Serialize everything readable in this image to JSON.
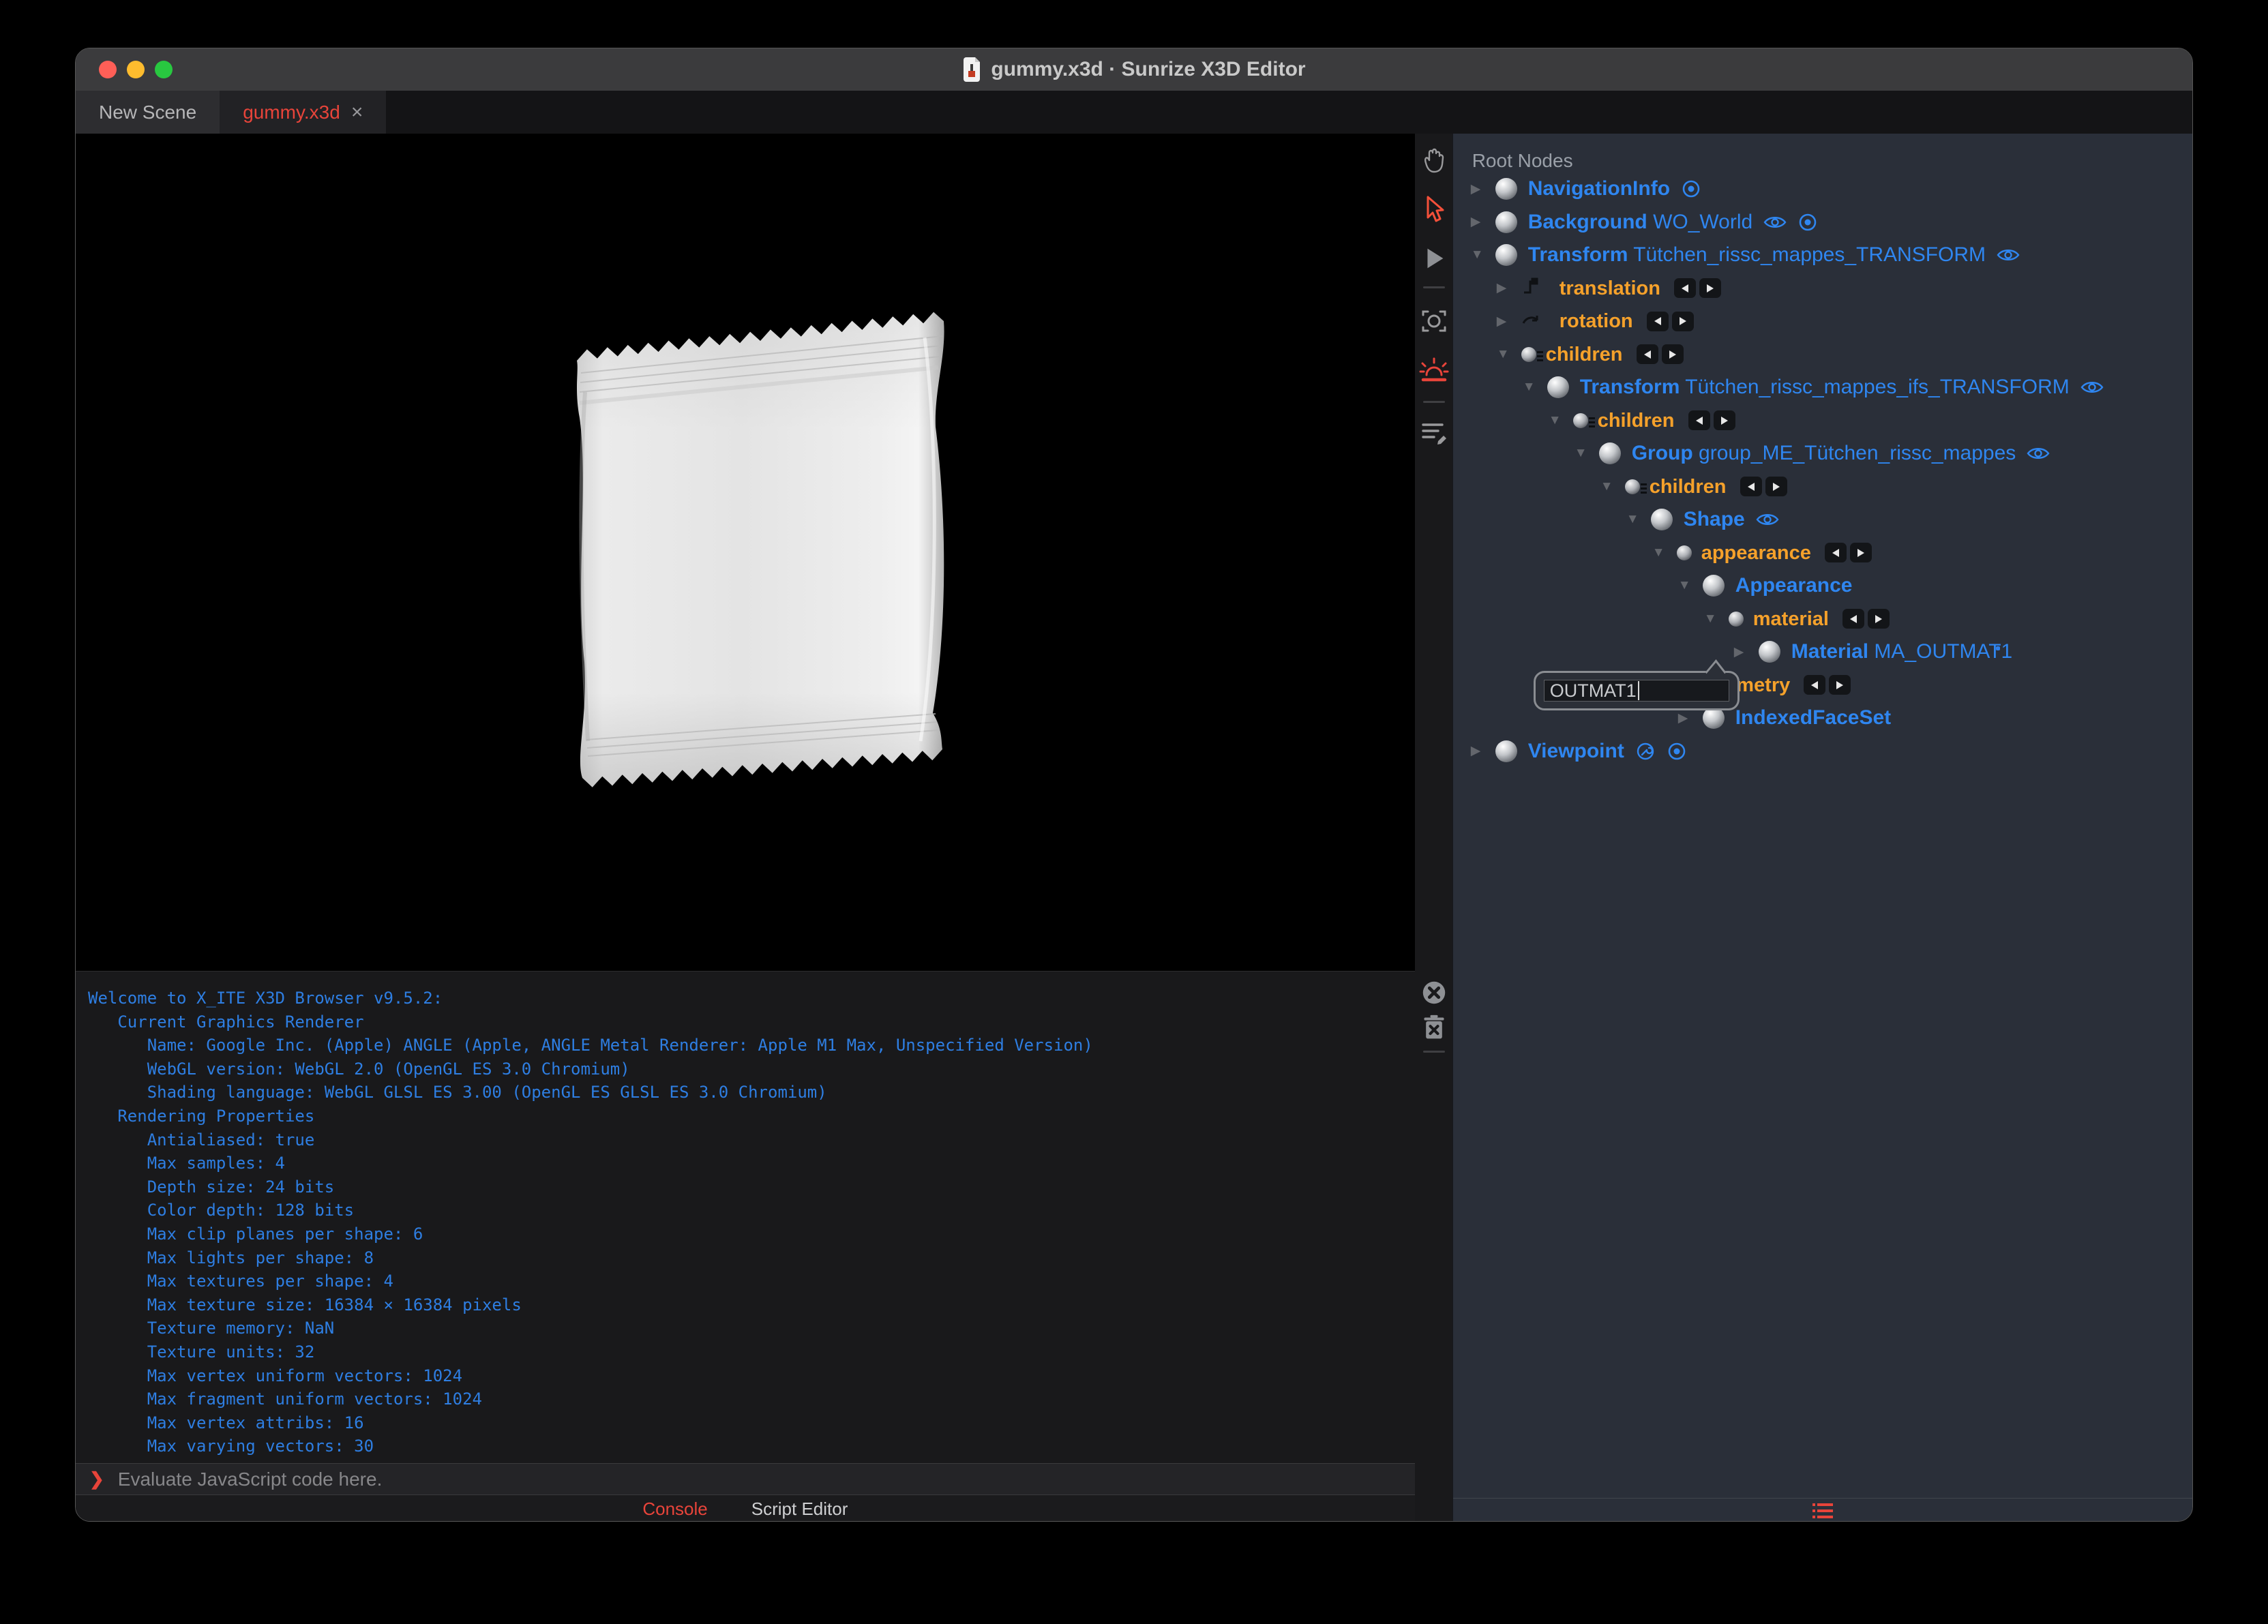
{
  "titlebar": {
    "title": "gummy.x3d · Sunrize X3D Editor"
  },
  "traffic_lights": [
    "close",
    "minimize",
    "zoom"
  ],
  "tabs": {
    "close_glyph": "×",
    "items": [
      {
        "label": "New Scene",
        "active": false,
        "closable": false
      },
      {
        "label": "gummy.x3d",
        "active": true,
        "closable": true
      }
    ]
  },
  "toolbar": {
    "icons": [
      "pan-hand",
      "select-arrow",
      "play",
      "snapshot-camera",
      "sunrise-light",
      "script-edit"
    ],
    "active_icons": [
      "select-arrow",
      "sunrise-light"
    ],
    "console_icons": [
      "clear-console",
      "clear-messages"
    ]
  },
  "viewport": {
    "content": "white flow-wrap pouch package on black background"
  },
  "console": {
    "lines": [
      "Welcome to X_ITE X3D Browser v9.5.2:",
      "   Current Graphics Renderer",
      "      Name: Google Inc. (Apple) ANGLE (Apple, ANGLE Metal Renderer: Apple M1 Max, Unspecified Version)",
      "      WebGL version: WebGL 2.0 (OpenGL ES 3.0 Chromium)",
      "      Shading language: WebGL GLSL ES 3.00 (OpenGL ES GLSL ES 3.0 Chromium)",
      "   Rendering Properties",
      "      Antialiased: true",
      "      Max samples: 4",
      "      Depth size: 24 bits",
      "      Color depth: 128 bits",
      "      Max clip planes per shape: 6",
      "      Max lights per shape: 8",
      "      Max textures per shape: 4",
      "      Max texture size: 16384 × 16384 pixels",
      "      Texture memory: NaN",
      "      Texture units: 32",
      "      Max vertex uniform vectors: 1024",
      "      Max fragment uniform vectors: 1024",
      "      Max vertex attribs: 16",
      "      Max varying vectors: 30"
    ],
    "prompt_glyph": "❯",
    "input_placeholder": "Evaluate JavaScript code here.",
    "input_value": "",
    "tabs": [
      {
        "label": "Console",
        "active": true
      },
      {
        "label": "Script Editor",
        "active": false
      }
    ]
  },
  "outline": {
    "header": "Root Nodes",
    "rows": [
      {
        "level": 0,
        "arrow": "collapsed",
        "icon": "sphere",
        "kind": "node",
        "type": "NavigationInfo",
        "def": "",
        "badges": [
          "bind"
        ]
      },
      {
        "level": 0,
        "arrow": "collapsed",
        "icon": "sphere",
        "kind": "node",
        "type": "Background",
        "def": "WO_World",
        "badges": [
          "eye",
          "bind"
        ]
      },
      {
        "level": 0,
        "arrow": "expanded",
        "icon": "sphere",
        "kind": "node",
        "type": "Transform",
        "def": "Tütchen_rissc_mappes_TRANSFORM",
        "badges": [
          "eye"
        ]
      },
      {
        "level": 1,
        "arrow": "collapsed",
        "icon": "translation-glyph",
        "kind": "field",
        "type": "translation",
        "routes": true
      },
      {
        "level": 1,
        "arrow": "collapsed",
        "icon": "rotation-glyph",
        "kind": "field",
        "type": "rotation",
        "routes": true
      },
      {
        "level": 1,
        "arrow": "expanded",
        "icon": "children",
        "kind": "field",
        "type": "children",
        "routes": true
      },
      {
        "level": 2,
        "arrow": "expanded",
        "icon": "sphere",
        "kind": "node",
        "type": "Transform",
        "def": "Tütchen_rissc_mappes_ifs_TRANSFORM",
        "badges": [
          "eye"
        ]
      },
      {
        "level": 3,
        "arrow": "expanded",
        "icon": "children",
        "kind": "field",
        "type": "children",
        "routes": true
      },
      {
        "level": 4,
        "arrow": "expanded",
        "icon": "sphere",
        "kind": "node",
        "type": "Group",
        "def": "group_ME_Tütchen_rissc_mappes",
        "badges": [
          "eye"
        ]
      },
      {
        "level": 5,
        "arrow": "expanded",
        "icon": "children",
        "kind": "field",
        "type": "children",
        "routes": true
      },
      {
        "level": 6,
        "arrow": "expanded",
        "icon": "sphere",
        "kind": "node",
        "type": "Shape",
        "def": "",
        "badges": [
          "eye"
        ]
      },
      {
        "level": 7,
        "arrow": "expanded",
        "icon": "dot",
        "kind": "field",
        "type": "appearance",
        "routes": true
      },
      {
        "level": 8,
        "arrow": "expanded",
        "icon": "sphere",
        "kind": "node",
        "type": "Appearance",
        "def": ""
      },
      {
        "level": 9,
        "arrow": "expanded",
        "icon": "dot",
        "kind": "field",
        "type": "material",
        "routes": true
      },
      {
        "level": 10,
        "arrow": "collapsed",
        "icon": "sphere",
        "kind": "node",
        "type": "Material",
        "def": "MA_OUTMAT1",
        "selected": true
      },
      {
        "level": 7,
        "arrow": "expanded",
        "icon": "dot",
        "kind": "field",
        "type": "geometry",
        "routes": true
      },
      {
        "level": 8,
        "arrow": "collapsed",
        "icon": "sphere",
        "kind": "node",
        "type": "IndexedFaceSet",
        "def": ""
      },
      {
        "level": 0,
        "arrow": "collapsed",
        "icon": "sphere",
        "kind": "node",
        "type": "Viewpoint",
        "def": "",
        "badges": [
          "wrench",
          "bind"
        ]
      }
    ],
    "name_popup": {
      "value": "OUTMAT1"
    },
    "footer_icon": "outline-list"
  },
  "colors": {
    "accent_red": "#e8443a",
    "node_blue": "#2f86f0",
    "field_orange": "#f5a12b",
    "selection_blue": "#2f7fe8",
    "console_blue": "#2e7ee2"
  }
}
